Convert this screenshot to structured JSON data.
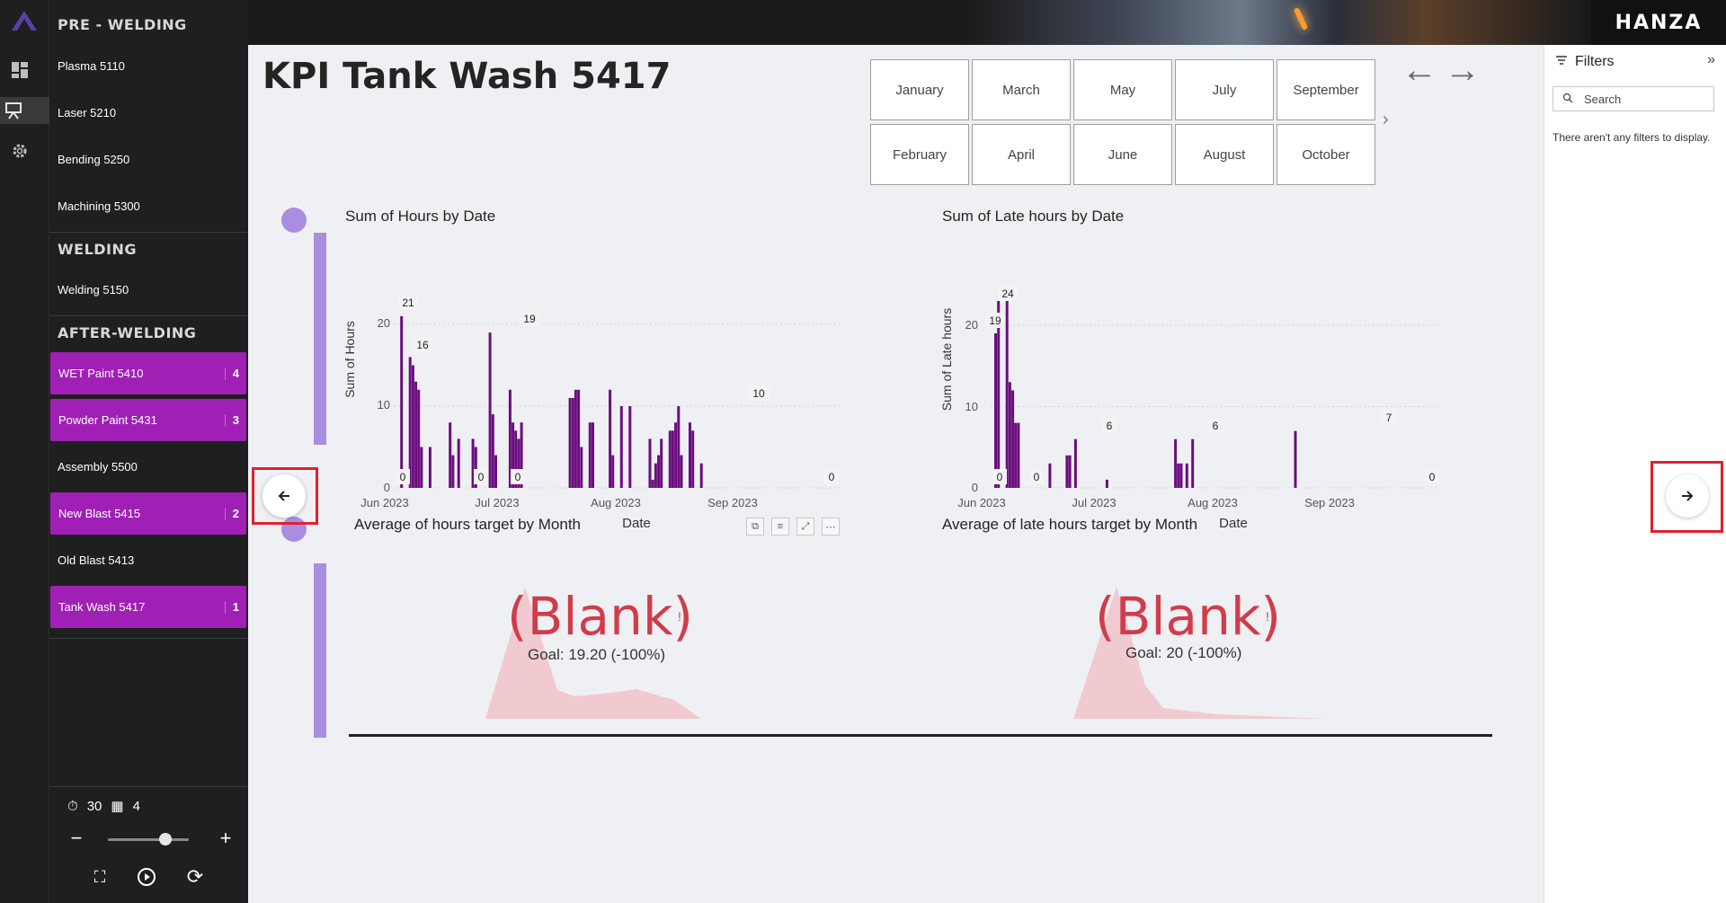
{
  "nav": {
    "sections": {
      "pre_welding": "PRE - WELDING",
      "welding": "WELDING",
      "after_welding": "AFTER-WELDING"
    },
    "items": [
      {
        "label": "Plasma 5110",
        "count": ""
      },
      {
        "label": "Laser 5210",
        "count": ""
      },
      {
        "label": "Bending 5250",
        "count": ""
      },
      {
        "label": "Machining 5300",
        "count": ""
      },
      {
        "label": "Welding 5150",
        "count": ""
      },
      {
        "label": "WET Paint 5410",
        "count": "4"
      },
      {
        "label": "Powder Paint 5431",
        "count": "3"
      },
      {
        "label": "Assembly 5500",
        "count": ""
      },
      {
        "label": "New Blast 5415",
        "count": "2"
      },
      {
        "label": "Old Blast 5413",
        "count": ""
      },
      {
        "label": "Tank Wash 5417",
        "count": "1"
      }
    ],
    "highlight_color": "#a020b5",
    "stats": {
      "timer": "30",
      "pages": "4"
    }
  },
  "banner": {
    "brand": "HANZA"
  },
  "page": {
    "title": "KPI Tank Wash 5417"
  },
  "months": [
    "January",
    "March",
    "May",
    "July",
    "September",
    "February",
    "April",
    "June",
    "August",
    "October"
  ],
  "charts": {
    "hours": {
      "title": "Sum of Hours by Date",
      "ylabel": "Sum of Hours",
      "xlabel": "Date",
      "yticks": [
        "0",
        "10",
        "20"
      ],
      "xticks": [
        "Jun 2023",
        "Jul 2023",
        "Aug 2023",
        "Sep 2023"
      ],
      "labels": [
        "21",
        "16",
        "19",
        "10",
        "0",
        "0",
        "0",
        "0"
      ]
    },
    "late": {
      "title": "Sum of Late hours by Date",
      "ylabel": "Sum of Late hours",
      "xlabel": "Date",
      "yticks": [
        "0",
        "10",
        "20"
      ],
      "xticks": [
        "Jun 2023",
        "Jul 2023",
        "Aug 2023",
        "Sep 2023"
      ],
      "labels": [
        "24",
        "19",
        "6",
        "6",
        "7",
        "0",
        "0",
        "0"
      ]
    },
    "avg_hours": {
      "title": "Average of hours target by Month",
      "value": "(Blank)",
      "goal": "Goal: 19.20 (-100%)"
    },
    "avg_late": {
      "title": "Average of late hours target by Month",
      "value": "(Blank)",
      "goal": "Goal: 20 (-100%)"
    }
  },
  "filters": {
    "title": "Filters",
    "search_placeholder": "Search",
    "empty": "There aren't any filters to display."
  },
  "chart_data": [
    {
      "type": "bar",
      "title": "Sum of Hours by Date",
      "xlabel": "Date",
      "ylabel": "Sum of Hours",
      "ylim": [
        0,
        24
      ],
      "x": [
        "2023-06-02",
        "2023-06-05",
        "2023-06-06",
        "2023-06-07",
        "2023-06-08",
        "2023-06-09",
        "2023-06-12",
        "2023-06-19",
        "2023-06-20",
        "2023-06-22",
        "2023-06-27",
        "2023-06-28",
        "2023-07-03",
        "2023-07-04",
        "2023-07-05",
        "2023-07-10",
        "2023-07-11",
        "2023-07-12",
        "2023-07-13",
        "2023-07-14",
        "2023-07-31",
        "2023-08-01",
        "2023-08-02",
        "2023-08-03",
        "2023-08-04",
        "2023-08-07",
        "2023-08-08",
        "2023-08-14",
        "2023-08-15",
        "2023-08-18",
        "2023-08-21",
        "2023-08-28",
        "2023-08-29",
        "2023-08-30",
        "2023-08-31",
        "2023-09-01",
        "2023-09-04",
        "2023-09-05",
        "2023-09-06",
        "2023-09-07",
        "2023-09-08",
        "2023-09-11",
        "2023-09-12",
        "2023-09-15"
      ],
      "values": [
        21,
        16,
        15,
        13,
        12,
        5,
        5,
        8,
        4,
        6,
        6,
        5,
        19,
        9,
        4,
        12,
        8,
        7,
        6,
        8,
        11,
        11,
        12,
        12,
        5,
        8,
        8,
        12,
        4,
        10,
        10,
        6,
        1,
        3,
        4,
        6,
        7,
        7,
        8,
        10,
        4,
        8,
        7,
        3
      ]
    },
    {
      "type": "bar",
      "title": "Sum of Late hours by Date",
      "xlabel": "Date",
      "ylabel": "Sum of Late hours",
      "ylim": [
        0,
        25
      ],
      "x": [
        "2023-06-01",
        "2023-06-02",
        "2023-06-05",
        "2023-06-06",
        "2023-06-07",
        "2023-06-08",
        "2023-06-09",
        "2023-06-20",
        "2023-06-26",
        "2023-06-27",
        "2023-06-29",
        "2023-07-10",
        "2023-08-03",
        "2023-08-04",
        "2023-08-05",
        "2023-08-07",
        "2023-08-09",
        "2023-09-14"
      ],
      "values": [
        19,
        23,
        24,
        13,
        12,
        8,
        8,
        3,
        4,
        4,
        6,
        1,
        6,
        3,
        3,
        3,
        6,
        7
      ]
    }
  ]
}
